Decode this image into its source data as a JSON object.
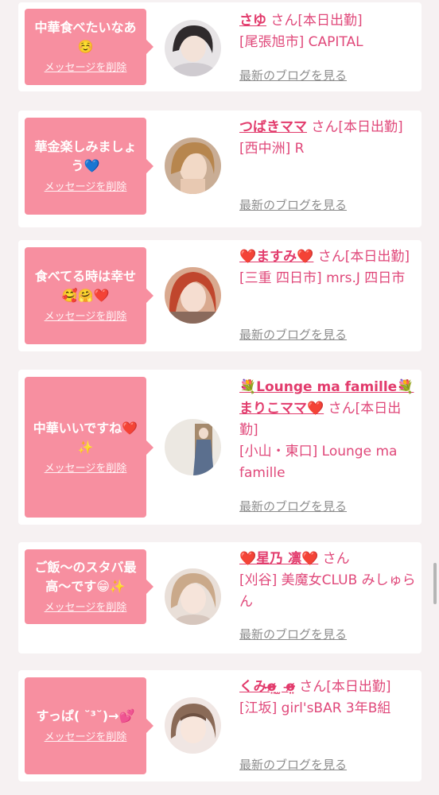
{
  "colors": {
    "bubble": "#f78fa0",
    "name": "#e23b6c",
    "text": "#e0487a",
    "link_gray": "#8d8d8d",
    "page_bg": "#f6f1f2"
  },
  "delete_label": "メッセージを削除",
  "blog_label": "最新のブログを見る",
  "cards": [
    {
      "message": "中華食べたいなあ☺️",
      "name": "さゆ",
      "suffix": "さん[本日出勤]",
      "shop": "[尾張旭市] CAPITAL",
      "avatar_icon": "profile-photo"
    },
    {
      "message": "華金楽しみましょう💙",
      "name": "つばきママ",
      "suffix": "さん[本日出勤]",
      "shop": "[西中洲] R",
      "avatar_icon": "profile-photo"
    },
    {
      "message": "食べてる時は幸せ🥰🤗❤️",
      "name": "❤️ますみ❤️",
      "suffix": "さん[本日出勤]",
      "shop": "[三重 四日市] mrs.J 四日市",
      "avatar_icon": "profile-photo"
    },
    {
      "message": "中華いいですね❤️✨",
      "name": "💐Lounge ma famille💐まりこママ❤️",
      "suffix": "さん[本日出勤]",
      "shop": "[小山・東口] Lounge ma famille",
      "avatar_icon": "profile-photo"
    },
    {
      "message": "ご飯〜のスタバ最高〜です😁✨",
      "name": "❤️星乃 凛❤️",
      "suffix": "さん",
      "shop": "[刈谷] 美魔女CLUB みしゅらん",
      "avatar_icon": "profile-photo"
    },
    {
      "message": "すっぱ( ˘³˘)→💕",
      "name": "くみo̴̶̷̤ ̫ o̴̶̷̤",
      "suffix": "さん[本日出勤]",
      "shop": "[江坂] girl'sBAR 3年B組",
      "avatar_icon": "profile-photo"
    }
  ]
}
